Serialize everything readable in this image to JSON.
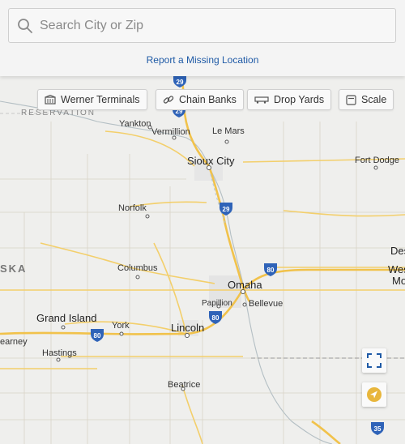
{
  "search": {
    "placeholder": "Search City or Zip",
    "value": ""
  },
  "report_link": "Report a Missing Location",
  "filters": [
    {
      "label": "Werner Terminals",
      "icon": "building-icon"
    },
    {
      "label": "Chain Banks",
      "icon": "link-icon"
    },
    {
      "label": "Drop Yards",
      "icon": "trailer-icon"
    },
    {
      "label": "Scale",
      "icon": "scale-icon"
    }
  ],
  "map": {
    "cities": {
      "yankton": "Yankton",
      "vermillion": "Vermillion",
      "le_mars": "Le Mars",
      "sioux_city": "Sioux City",
      "fort_dodge": "Fort Dodge",
      "norfolk": "Norfolk",
      "columbus": "Columbus",
      "omaha": "Omaha",
      "papillion": "Papillion",
      "bellevue": "Bellevue",
      "grand_island": "Grand Island",
      "york": "York",
      "lincoln": "Lincoln",
      "kearney": "earney",
      "hastings": "Hastings",
      "beatrice": "Beatrice",
      "des": "Des",
      "west": "West",
      "mo": "Mo"
    },
    "state_label": "SKA",
    "reservation_label": "RESERVATION",
    "highways": [
      "29",
      "29",
      "80",
      "80",
      "80",
      "35"
    ]
  }
}
